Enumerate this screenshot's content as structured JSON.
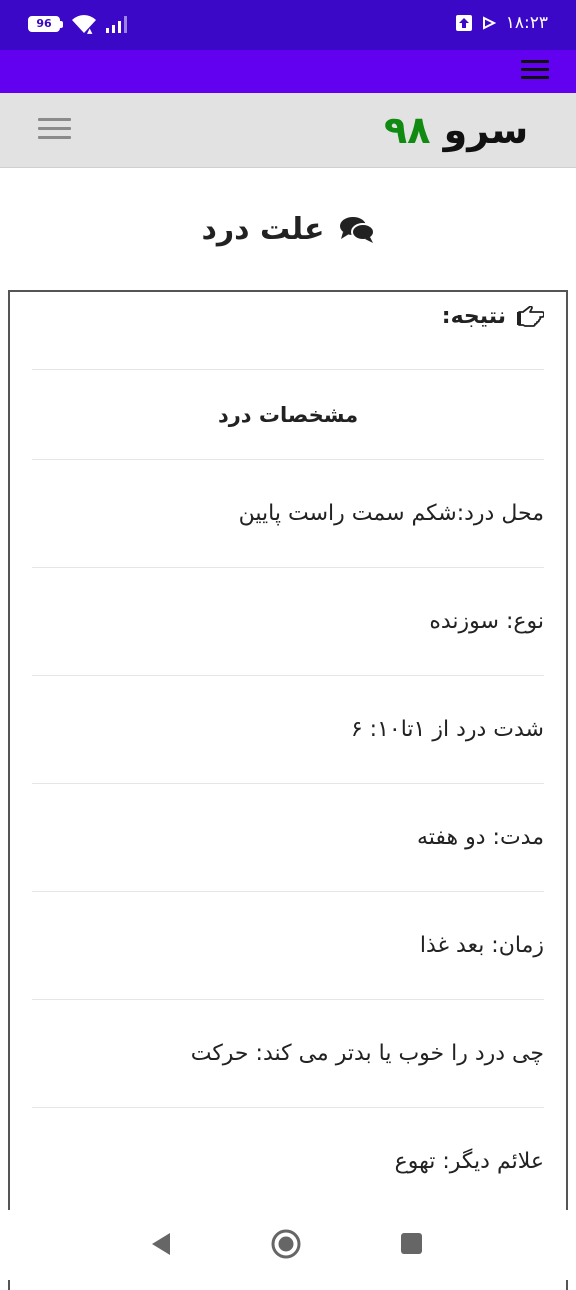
{
  "status_bar": {
    "battery": "96",
    "clock": "۱۸:۲۳"
  },
  "header": {
    "logo_word": "سرو",
    "logo_number": "۹۸"
  },
  "page": {
    "title": "علت درد"
  },
  "result": {
    "label": "نتیجه:",
    "heading": "مشخصات درد",
    "rows": [
      "محل درد:شکم سمت راست پایین",
      "نوع: سوزنده",
      "شدت درد از ۱تا۱۰: ۶",
      "مدت: دو هفته",
      "زمان: بعد غذا",
      "چی درد را خوب یا بدتر می کند: حرکت",
      "علائم دیگر: تهوع"
    ]
  },
  "colors": {
    "status_bar": "#3a08c6",
    "app_bar": "#6200f0",
    "logo_number": "#118a11",
    "site_header": "#e2e2e2"
  },
  "icons": {
    "page_title": "comments-icon",
    "result": "hand-pointer-icon"
  }
}
